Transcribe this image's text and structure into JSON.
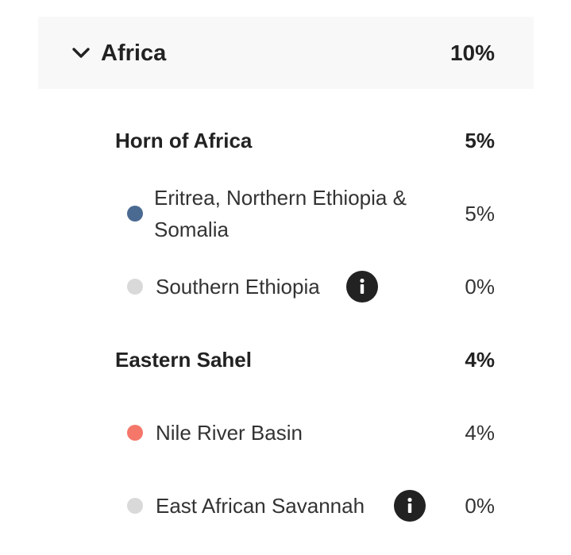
{
  "region": {
    "name": "Africa",
    "percent": "10%",
    "expanded": true,
    "icon": "chevron-down-icon"
  },
  "subregions": [
    {
      "name": "Horn of Africa",
      "percent": "5%",
      "items": [
        {
          "name": "Eritrea, Northern Ethiopia & Somalia",
          "percent": "5%",
          "color": "#4a6a92",
          "info": false
        },
        {
          "name": "Southern Ethiopia",
          "percent": "0%",
          "color": "#d9d9d9",
          "info": true
        }
      ]
    },
    {
      "name": "Eastern Sahel",
      "percent": "4%",
      "items": [
        {
          "name": "Nile River Basin",
          "percent": "4%",
          "color": "#f4776a",
          "info": false
        },
        {
          "name": "East African Savannah",
          "percent": "0%",
          "color": "#d9d9d9",
          "info": true
        }
      ]
    }
  ],
  "colors": {
    "header_background": "#f8f8f8",
    "info_icon_background": "#222222"
  }
}
